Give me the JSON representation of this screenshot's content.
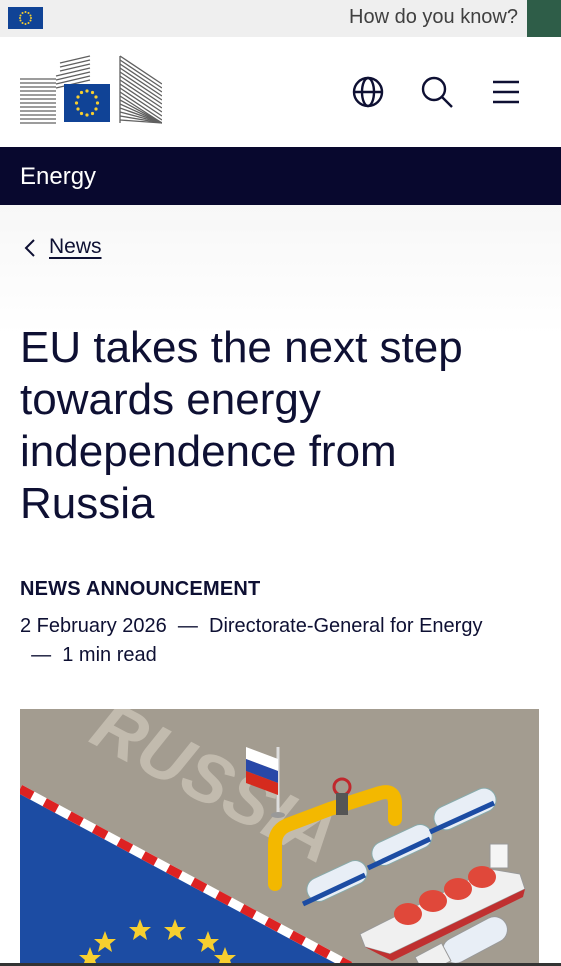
{
  "banner": {
    "how_know": "How do you know?",
    "eu_flag": "eu-flag-icon"
  },
  "header": {
    "logo": "european-commission-logo",
    "icons": [
      "globe-icon",
      "search-icon",
      "menu-icon"
    ]
  },
  "site": {
    "name": "Energy"
  },
  "breadcrumb": {
    "back_label": "News"
  },
  "article": {
    "title": "EU takes the next step towards energy independence from Russia",
    "type": "NEWS ANNOUNCEMENT",
    "date": "2 February 2026",
    "author": "Directorate-General for Energy",
    "read_time": "1 min read"
  },
  "hero": {
    "overlay_text": "RUSSIA"
  },
  "colors": {
    "dark_navy": "#08082e",
    "eu_blue": "#104396",
    "gold": "#f7cf2f",
    "hero_beige": "#a39c90"
  }
}
